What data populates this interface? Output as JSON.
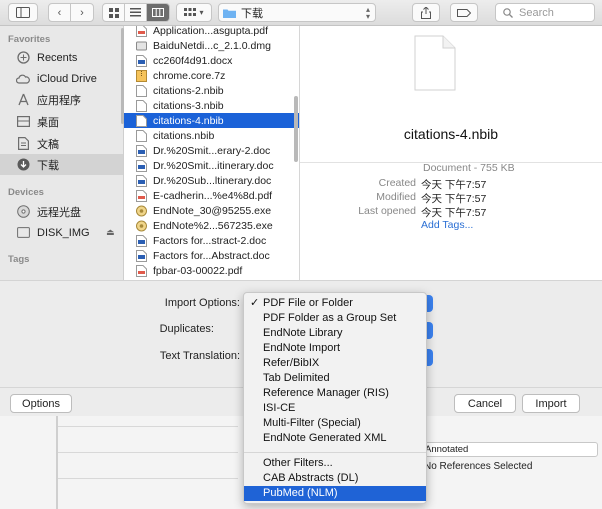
{
  "toolbar": {
    "location": "下载",
    "search_placeholder": "Search"
  },
  "sidebar": {
    "favorites_header": "Favorites",
    "favorites": [
      {
        "label": "Recents",
        "icon": "recents-icon"
      },
      {
        "label": "iCloud Drive",
        "icon": "cloud-icon"
      },
      {
        "label": "应用程序",
        "icon": "applications-icon"
      },
      {
        "label": "桌面",
        "icon": "desktop-icon"
      },
      {
        "label": "文稿",
        "icon": "documents-icon"
      },
      {
        "label": "下载",
        "icon": "downloads-icon",
        "selected": true
      }
    ],
    "devices_header": "Devices",
    "devices": [
      {
        "label": "远程光盘",
        "icon": "disc-icon"
      },
      {
        "label": "DISK_IMG",
        "icon": "disk-icon"
      }
    ],
    "tags_header": "Tags"
  },
  "files": [
    {
      "name": "Application...asgupta.pdf",
      "kind": "pdf"
    },
    {
      "name": "BaiduNetdi...c_2.1.0.dmg",
      "kind": "dmg"
    },
    {
      "name": "cc260f4d91.docx",
      "kind": "doc"
    },
    {
      "name": "chrome.core.7z",
      "kind": "zip"
    },
    {
      "name": "citations-2.nbib",
      "kind": "file"
    },
    {
      "name": "citations-3.nbib",
      "kind": "file"
    },
    {
      "name": "citations-4.nbib",
      "kind": "file",
      "selected": true
    },
    {
      "name": "citations.nbib",
      "kind": "file"
    },
    {
      "name": "Dr.%20Smit...erary-2.doc",
      "kind": "doc"
    },
    {
      "name": "Dr.%20Smit...itinerary.doc",
      "kind": "doc"
    },
    {
      "name": "Dr.%20Sub...ltinerary.doc",
      "kind": "doc"
    },
    {
      "name": "E-cadherin...%e4%8d.pdf",
      "kind": "pdf"
    },
    {
      "name": "EndNote_30@95255.exe",
      "kind": "exe"
    },
    {
      "name": "EndNote%2...567235.exe",
      "kind": "exe"
    },
    {
      "name": "Factors for...stract-2.doc",
      "kind": "doc"
    },
    {
      "name": "Factors for...Abstract.doc",
      "kind": "doc"
    },
    {
      "name": "fpbar-03-00022.pdf",
      "kind": "pdf"
    }
  ],
  "preview": {
    "filename": "citations-4.nbib",
    "kind_size": "Document - 755 KB",
    "created_label": "Created",
    "created": "今天 下午7:57",
    "modified_label": "Modified",
    "modified": "今天 下午7:57",
    "last_opened_label": "Last opened",
    "last_opened": "今天 下午7:57",
    "add_tags": "Add Tags..."
  },
  "options": {
    "import_label": "Import Options:",
    "duplicates_label": "Duplicates:",
    "translation_label": "Text Translation:"
  },
  "buttons": {
    "options": "Options",
    "cancel": "Cancel",
    "import": "Import"
  },
  "background": {
    "annotated": "Annotated",
    "no_refs": "No References Selected"
  },
  "menu": {
    "group1": [
      {
        "label": "PDF File or Folder",
        "checked": true
      },
      {
        "label": "PDF Folder as a Group Set"
      },
      {
        "label": "EndNote Library"
      },
      {
        "label": "EndNote Import"
      },
      {
        "label": "Refer/BibIX"
      },
      {
        "label": "Tab Delimited"
      },
      {
        "label": "Reference Manager (RIS)"
      },
      {
        "label": "ISI-CE"
      },
      {
        "label": "Multi-Filter (Special)"
      },
      {
        "label": "EndNote Generated XML"
      }
    ],
    "group2": [
      {
        "label": "Other Filters..."
      },
      {
        "label": "CAB Abstracts (DL)"
      },
      {
        "label": "PubMed (NLM)",
        "highlighted": true
      }
    ],
    "check_mark": "✓"
  },
  "colors": {
    "selection": "#1b62d8",
    "menu_highlight": "#1f63d6",
    "link": "#2a6fd4"
  }
}
